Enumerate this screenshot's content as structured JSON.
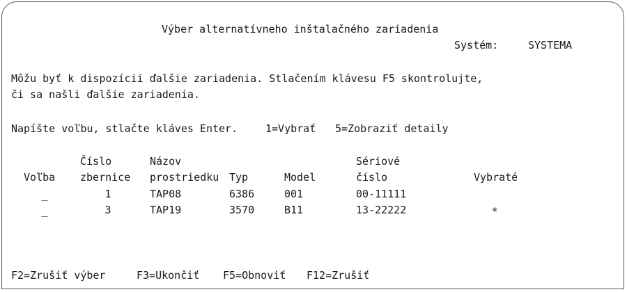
{
  "screen": {
    "title": "Výber alternatívneho inštalačného zariadenia",
    "system_label": "Systém:",
    "system_name": "SYSTEMA"
  },
  "info": {
    "line1": "Môžu byť k dispozícii ďalšie zariadenia. Stlačením klávesu F5 skontrolujte,",
    "line2": "či sa našli ďalšie zariadenia."
  },
  "instructions": {
    "prompt": "Napíšte voľbu, stlačte kláves Enter.",
    "option1": "1=Vybrať",
    "option5": "5=Zobraziť detaily"
  },
  "table": {
    "headers": {
      "bus_top": "Číslo",
      "name_top": "Názov",
      "serial_top": "Sériové",
      "option": "Voľba",
      "bus": "zbernice",
      "name": "prostriedku",
      "type": "Typ",
      "model": "Model",
      "serial": "číslo",
      "selected": "Vybraté"
    },
    "rows": [
      {
        "option": "_",
        "bus": "1",
        "name": "TAP08",
        "type": "6386",
        "model": "001",
        "serial": "00-11111",
        "selected": ""
      },
      {
        "option": "_",
        "bus": "3",
        "name": "TAP19",
        "type": "3570",
        "model": "B11",
        "serial": "13-22222",
        "selected": "*"
      }
    ]
  },
  "function_keys": [
    "F2=Zrušiť výber",
    "F3=Ukončiť",
    "F5=Obnoviť",
    "F12=Zrušiť"
  ]
}
